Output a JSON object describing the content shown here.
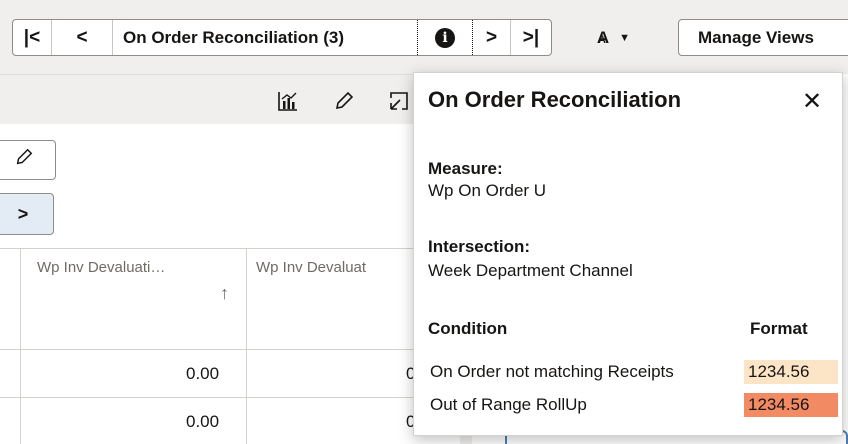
{
  "toolbar": {
    "first_label": "|<",
    "prev_label": "<",
    "view_title": "On Order Reconciliation (3)",
    "info_glyph": "i",
    "next_label": ">",
    "last_label": ">|",
    "font_label": "A",
    "font_small_label": "A",
    "manage_views_label": "Manage Views"
  },
  "pane_icons": [
    "chart-icon",
    "pencil-icon",
    "expand-icon"
  ],
  "grid": {
    "columns": [
      "Wp Inv Devaluati…",
      "Wp Inv Devaluat"
    ],
    "sort_glyph": "↑",
    "rows": [
      [
        "0.00",
        "0."
      ],
      [
        "0.00",
        "0."
      ]
    ]
  },
  "popup": {
    "title": "On Order Reconciliation",
    "close_glyph": "✕",
    "measure_label": "Measure:",
    "measure_value": "Wp On Order U",
    "intersection_label": "Intersection:",
    "intersection_value": "Week Department Channel",
    "condition_header": "Condition",
    "format_header": "Format",
    "conditions": [
      {
        "name": "On Order not matching Receipts",
        "sample": "1234.56",
        "color": "#fce4c7"
      },
      {
        "name": "Out of Range RollUp",
        "sample": "1234.56",
        "color": "#f28a63"
      }
    ]
  },
  "colors": {
    "toolbar_bg": "#f1efed",
    "border": "#8f8b86",
    "selected_bg": "#e3ecf5"
  }
}
